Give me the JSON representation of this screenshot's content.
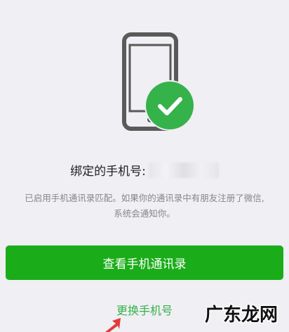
{
  "colors": {
    "background": "#efeff4",
    "brand_green": "#1aad19",
    "check_green": "#35b24a",
    "phone_gray": "#5a5a5a",
    "text_dark": "#222222",
    "text_muted": "#888888",
    "arrow_red": "#e23b3b"
  },
  "hero": {
    "phone_icon": "mobile-phone-icon",
    "badge_icon": "checkmark-icon"
  },
  "bound": {
    "label": "绑定的手机号:"
  },
  "description": {
    "line1": "已启用手机通讯录匹配。如果你的通讯录中有朋友注册了微信,",
    "line2": "系统会通知你。"
  },
  "actions": {
    "view_contacts": "查看手机通讯录",
    "change_phone": "更换手机号"
  },
  "watermark": {
    "text": "广东龙网"
  }
}
